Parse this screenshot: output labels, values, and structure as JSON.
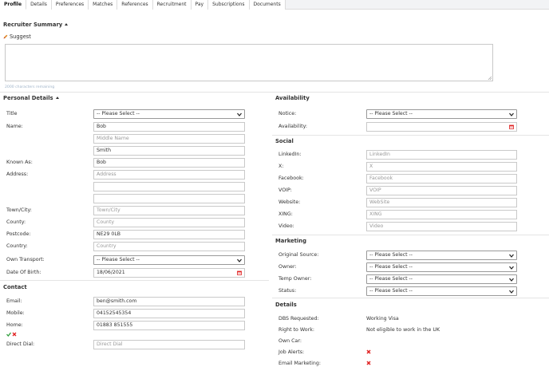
{
  "tabs": [
    "Profile",
    "Details",
    "Preferences",
    "Matches",
    "References",
    "Recruitment",
    "Pay",
    "Subscriptions",
    "Documents"
  ],
  "recruiter_summary": {
    "title": "Recruiter Summary",
    "suggest_label": "Suggest",
    "chars_remaining": "2000 characters remaining"
  },
  "personal": {
    "title": "Personal Details",
    "title_label": "Title",
    "title_value": "-- Please Select --",
    "name_label": "Name:",
    "first_name": "Bob",
    "middle_name_placeholder": "Middle Name",
    "last_name": "Smith",
    "known_as_label": "Known As:",
    "known_as": "Bob",
    "address_label": "Address:",
    "address_placeholder": "Address",
    "town_label": "Town/City:",
    "town_placeholder": "Town/City",
    "county_label": "County:",
    "county_placeholder": "County",
    "postcode_label": "Postcode:",
    "postcode": "NE29 0LB",
    "country_label": "Country:",
    "country_placeholder": "Country",
    "transport_label": "Own Transport:",
    "transport_value": "-- Please Select --",
    "dob_label": "Date Of Birth:",
    "dob": "18/06/2021"
  },
  "contact": {
    "title": "Contact",
    "email_label": "Email:",
    "email": "ben@smith.com",
    "mobile_label": "Mobile:",
    "mobile": "04152545354",
    "home_label": "Home:",
    "home": "01883 851555",
    "direct_label": "Direct Dial:",
    "direct_placeholder": "Direct Dial"
  },
  "availability": {
    "title": "Availability",
    "notice_label": "Notice:",
    "notice_value": "-- Please Select --",
    "availability_label": "Availability:"
  },
  "social": {
    "title": "Social",
    "items": [
      {
        "label": "LinkedIn:",
        "placeholder": "LinkedIn"
      },
      {
        "label": "X:",
        "placeholder": "X"
      },
      {
        "label": "Facebook:",
        "placeholder": "Facebook"
      },
      {
        "label": "VOIP:",
        "placeholder": "VOIP"
      },
      {
        "label": "Website:",
        "placeholder": "WebSite"
      },
      {
        "label": "XING:",
        "placeholder": "XING"
      },
      {
        "label": "Video:",
        "placeholder": "Video"
      }
    ]
  },
  "marketing": {
    "title": "Marketing",
    "items": [
      {
        "label": "Original Source:",
        "value": "-- Please Select --"
      },
      {
        "label": "Owner:",
        "value": "-- Please Select --"
      },
      {
        "label": "Temp Owner:",
        "value": "-- Please Select --"
      },
      {
        "label": "Status:",
        "value": "-- Please Select --"
      }
    ]
  },
  "details": {
    "title": "Details",
    "dbs_label": "DBS Requested:",
    "dbs_value": "Working Visa",
    "rtw_label": "Right to Work:",
    "rtw_value": "Not eligible to work in the UK",
    "own_car_label": "Own Car:",
    "job_alerts_label": "Job Alerts:",
    "email_marketing_label": "Email Marketing:"
  },
  "colors": {
    "accent_red": "#e02020",
    "check_green": "#2e9e3a"
  }
}
